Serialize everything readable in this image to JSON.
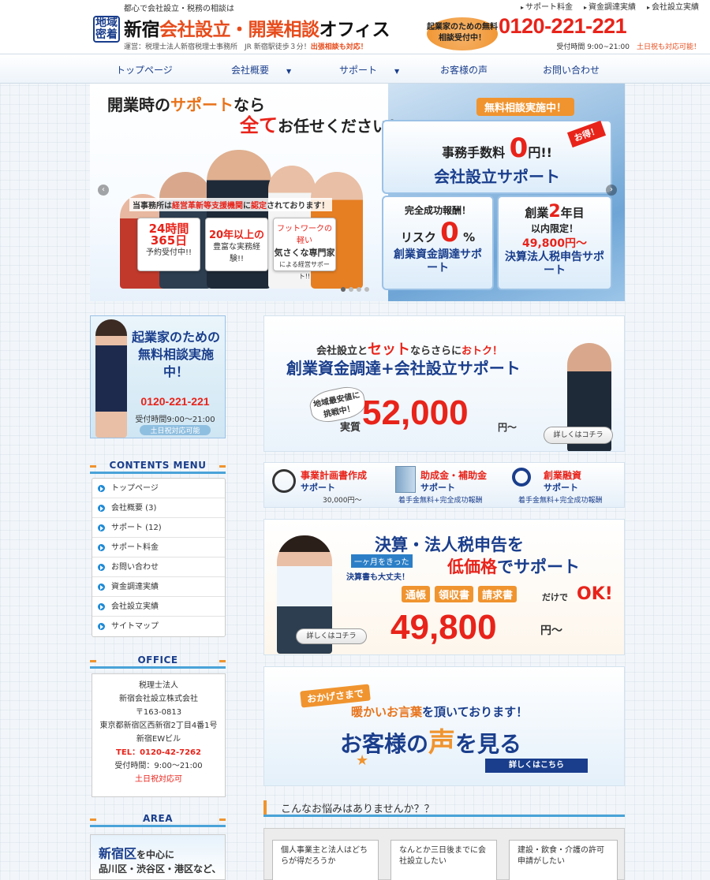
{
  "header": {
    "tagline": "都心で会社設立・税務の相談は",
    "top_links": [
      "サポート料金",
      "資金調達実績",
      "会社設立実績"
    ],
    "badge": "地域密着",
    "title_a": "新宿",
    "title_b": "会社設立・開業相談",
    "title_c": "オフィス",
    "operator": "運営：税理士法人新宿税理士事務所　JR 新宿駅徒歩３分！",
    "operator_highlight": "出張相談も対応！",
    "consult_label": "起業家のための無料相談受付中！",
    "phone": "0120-221-221",
    "hours": "受付時間 9:00~21:00",
    "hours_highlight": "土日祝も対応可能！"
  },
  "nav": [
    "トップページ",
    "会社概要",
    "サポート",
    "お客様の声",
    "お問い合わせ"
  ],
  "hero": {
    "headline_1": "開業時の",
    "headline_2": "サポート",
    "headline_3": "なら",
    "headline_4": "全て",
    "headline_5": "お任せください！",
    "consult_tag": "無料相談実施中！",
    "otoku": "お得！",
    "fee_label": "事務手数料",
    "fee_value": "0",
    "fee_unit": "円!!",
    "setup_support": "会社設立サポート",
    "reward_label": "完全成功報酬！",
    "risk_label": "リスク",
    "risk_value": "0",
    "risk_unit": "%",
    "fund_support": "創業資金調達サポート",
    "year_label_a": "創業",
    "year_value": "2",
    "year_label_b": "年目",
    "limited": "以内限定！",
    "limited_price": "49,800円〜",
    "tax_support": "決算法人税申告サポート",
    "cert_line": "当事務所は",
    "cert_highlight": "経営革新等支援機関",
    "cert_line2": "に",
    "cert_highlight2": "認定",
    "cert_line3": "されております！",
    "card1": [
      "24時間",
      "365日",
      "予約受付中!!"
    ],
    "card2": [
      "20年以上の",
      "豊富な実務経験!!"
    ],
    "card3": [
      "フットワークの軽い",
      "気さくな専門家",
      "による経営サポート!!"
    ]
  },
  "sidebar": {
    "consult_title": "起業家のための無料相談実施中！",
    "consult_phone": "0120-221-221",
    "consult_hours": "受付時間9:00〜21:00",
    "consult_note": "土日祝対応可能",
    "menu_title": "CONTENTS MENU",
    "menu": [
      "トップページ",
      "会社概要 (3)",
      "サポート (12)",
      "サポート料金",
      "お問い合わせ",
      "資金調達実績",
      "会社設立実績",
      "サイトマップ"
    ],
    "office_title": "OFFICE",
    "office": [
      "税理士法人",
      "新宿会社設立株式会社",
      "〒163-0813",
      "東京都新宿区西新宿2丁目4番1号",
      "新宿EWビル"
    ],
    "office_tel": "TEL：0120-42-7262",
    "office_hours": "受付時間：9:00〜21:00",
    "office_note": "土日祝対応可",
    "area_title": "AREA",
    "area_line1": "新宿区",
    "area_line1b": "を中心に",
    "area_line2": "品川区・渋谷区・港区など、"
  },
  "main": {
    "b1_line1": "会社設立と",
    "b1_set": "セット",
    "b1_line1b": "ならさらに",
    "b1_otoku": "おトク！",
    "b1_title": "創業資金調達+会社設立サポート",
    "b1_challenge": "地域最安値に挑戦中！",
    "b1_real": "実質",
    "b1_price": "52,000",
    "b1_unit": "円〜",
    "b1_btn": "詳しくはコチラ",
    "services": [
      {
        "title": "事業計画書作成",
        "sub": "サポート",
        "price": "30,000円〜",
        "icon": "stopwatch-icon"
      },
      {
        "title": "助成金・補助金",
        "sub": "サポート",
        "price": "着手金無料+完全成功報酬",
        "icon": "building-icon"
      },
      {
        "title": "創業融資",
        "sub": "サポート",
        "price": "着手金無料+完全成功報酬",
        "icon": "magnifier-icon"
      }
    ],
    "b2_title1": "決算・法人税申告を",
    "b2_title2": "低価格",
    "b2_title2b": "でサポート",
    "b2_month": "一ヶ月をきった",
    "b2_month2": "決算書も大丈夫！",
    "b2_tags": [
      "通帳",
      "領収書",
      "請求書"
    ],
    "b2_only": "だけで",
    "b2_ok": "OK!",
    "b2_price": "49,800",
    "b2_unit": "円〜",
    "b2_btn": "詳しくはコチラ",
    "b3_tag": "おかげさまで",
    "b3_line": "暖かいお言葉",
    "b3_line2": "を頂いております！",
    "b3_title_a": "お客様の",
    "b3_title_b": "声",
    "b3_title_c": "を見る",
    "b3_btn": "詳しくはこちら",
    "worries_title": "こんなお悩みはありませんか？？",
    "worries": [
      "個人事業主と法人はどちらが得だろうか",
      "なんとか三日後までに会社設立したい",
      "建設・飲食・介護の許可申請がしたい"
    ]
  }
}
